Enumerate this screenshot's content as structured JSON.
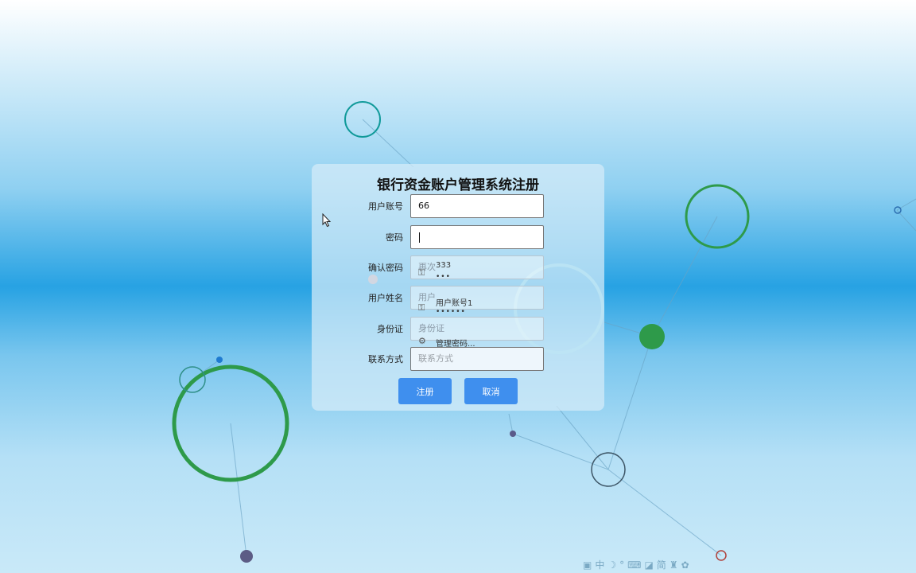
{
  "form": {
    "title": "银行资金账户管理系统注册",
    "fields": [
      {
        "label": "用户账号",
        "value": "66",
        "placeholder": ""
      },
      {
        "label": "密码",
        "value": "",
        "placeholder": ""
      },
      {
        "label": "确认密码",
        "value": "",
        "placeholder": "再次"
      },
      {
        "label": "用户姓名",
        "value": "",
        "placeholder": "用户"
      },
      {
        "label": "身份证",
        "value": "",
        "placeholder": "身份证"
      },
      {
        "label": "联系方式",
        "value": "",
        "placeholder": "联系方式"
      }
    ],
    "submit_label": "注册",
    "cancel_label": "取消"
  },
  "autofill": {
    "entries": [
      {
        "username": "333",
        "password_mask": "•••"
      },
      {
        "username": "用户账号1",
        "password_mask": "••••••"
      }
    ],
    "manage_label": "管理密码..."
  },
  "ime_toolbar": {
    "text": "中",
    "mode": "简"
  },
  "colors": {
    "accent_button": "#3f8fee",
    "node_green": "#2e9a4a",
    "node_teal": "#119a9a"
  }
}
